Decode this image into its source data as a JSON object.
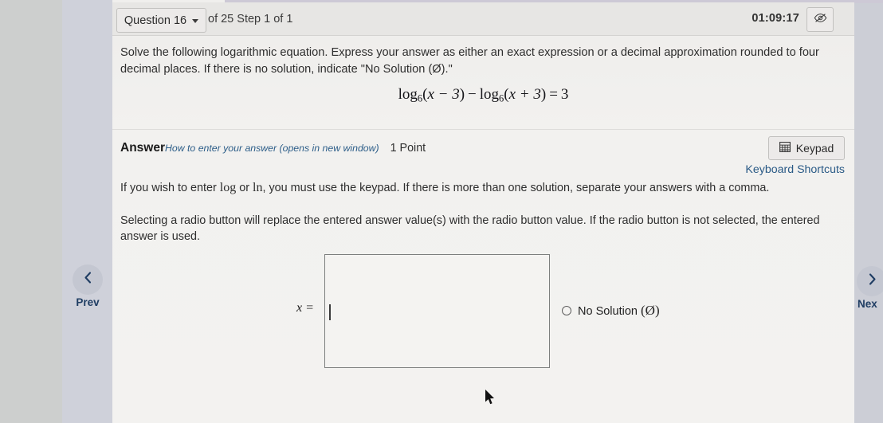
{
  "header": {
    "question_select_label": "Question 16",
    "caret_icon": "chevron-down-icon",
    "step_label": "of 25 Step 1 of 1",
    "timer": "01:09:17",
    "hide_timer_icon": "eye-slash-icon"
  },
  "question": {
    "prompt": "Solve the following logarithmic equation. Express your answer as either an exact expression or a decimal approximation rounded to four decimal places. If there is no solution, indicate \"No Solution (Ø).\"",
    "equation": {
      "plain": "log_6(x - 3) - log_6(x + 3) = 3",
      "log_name": "log",
      "base": "6",
      "arg1_open": "(",
      "arg1": "x − 3",
      "arg1_close": ")",
      "operator": "−",
      "arg2_open": "(",
      "arg2": "x + 3",
      "arg2_close": ")",
      "equals": "=",
      "rhs": "3"
    }
  },
  "answer": {
    "title": "Answer",
    "how_to_link": "How to enter your answer (opens in new window)",
    "points": "1 Point",
    "keypad_button": "Keypad",
    "keypad_icon": "keypad-grid-icon",
    "keyboard_shortcuts": "Keyboard Shortcuts",
    "hint_keypad_pre": "If you wish to enter ",
    "hint_keypad_log": "log",
    "hint_keypad_mid": " or ",
    "hint_keypad_ln": "ln",
    "hint_keypad_post": ", you must use the keypad. If there is more than one solution, separate your answers with a comma.",
    "hint_radio": "Selecting a radio button will replace the entered answer value(s) with the radio button value. If the radio button is not selected, the entered answer is used.",
    "x_equals_label": "x =",
    "input_value": "",
    "input_placeholder": "",
    "no_solution_label": "No Solution",
    "no_solution_symbol": "(Ø)",
    "no_solution_selected": false
  },
  "nav": {
    "prev_label": "Prev",
    "prev_icon": "chevron-left-icon",
    "next_label": "Nex",
    "next_icon": "chevron-right-icon"
  },
  "colors": {
    "link": "#2a5a86",
    "nav_text": "#1f3d63",
    "card_bg": "#f2f1ef",
    "page_bg": "#cdcfce"
  }
}
